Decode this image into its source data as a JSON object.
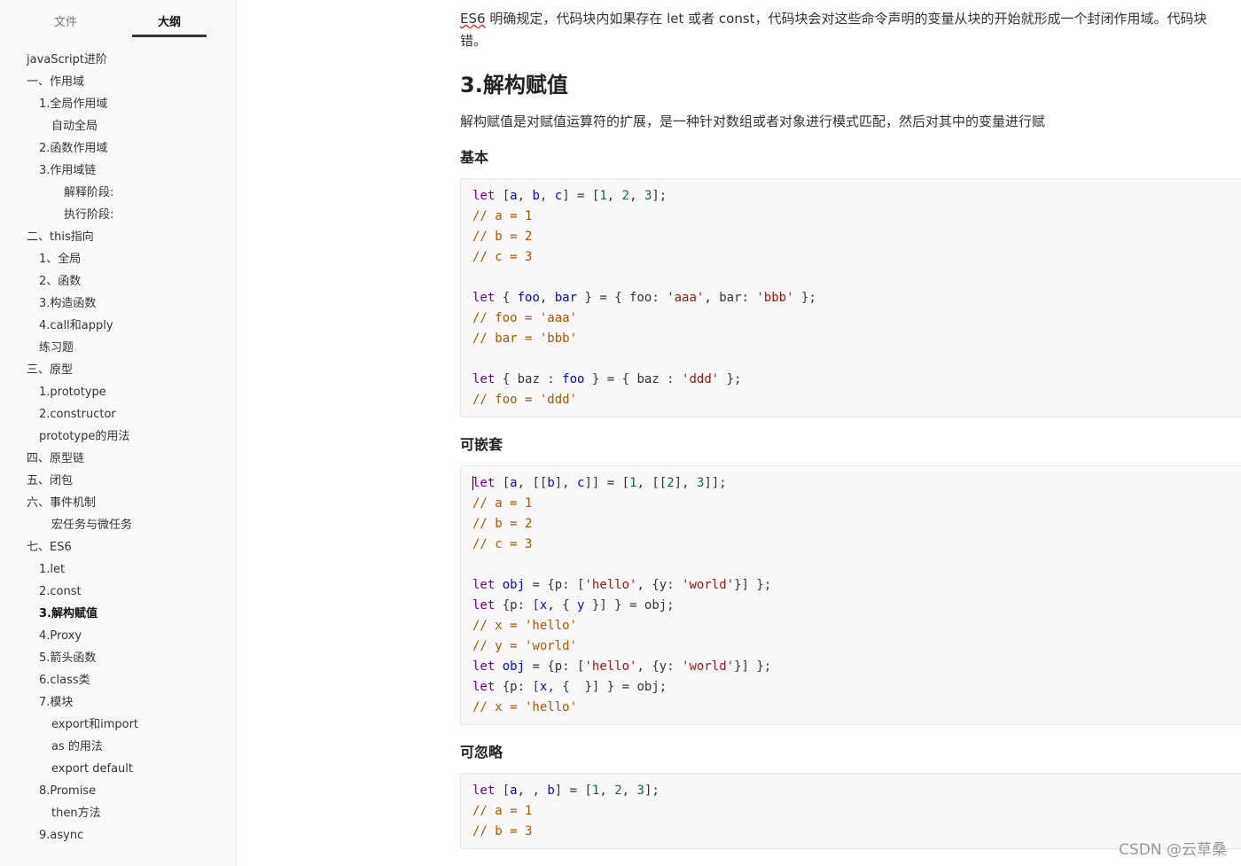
{
  "sidebar": {
    "tabs": [
      {
        "label": "文件",
        "active": false
      },
      {
        "label": "大纲",
        "active": true
      }
    ],
    "outline": [
      {
        "label": "javaScript进阶",
        "level": 1
      },
      {
        "label": "一、作用域",
        "level": 1
      },
      {
        "label": "1.全局作用域",
        "level": 2
      },
      {
        "label": "自动全局",
        "level": 3
      },
      {
        "label": "2.函数作用域",
        "level": 2
      },
      {
        "label": "3.作用域链",
        "level": 2
      },
      {
        "label": "解释阶段:",
        "level": 4
      },
      {
        "label": "执行阶段:",
        "level": 4
      },
      {
        "label": "二、this指向",
        "level": 1
      },
      {
        "label": "1、全局",
        "level": 2
      },
      {
        "label": "2、函数",
        "level": 2
      },
      {
        "label": "3.构造函数",
        "level": 2
      },
      {
        "label": "4.call和apply",
        "level": 2
      },
      {
        "label": "练习题",
        "level": 2
      },
      {
        "label": "三、原型",
        "level": 1
      },
      {
        "label": "1.prototype",
        "level": 2
      },
      {
        "label": "2.constructor",
        "level": 2
      },
      {
        "label": "prototype的用法",
        "level": 2
      },
      {
        "label": "四、原型链",
        "level": 1
      },
      {
        "label": "五、闭包",
        "level": 1
      },
      {
        "label": "六、事件机制",
        "level": 1
      },
      {
        "label": "宏任务与微任务",
        "level": 3
      },
      {
        "label": "七、ES6",
        "level": 1
      },
      {
        "label": "1.let",
        "level": 2
      },
      {
        "label": "2.const",
        "level": 2
      },
      {
        "label": "3.解构赋值",
        "level": 2,
        "active": true
      },
      {
        "label": "4.Proxy",
        "level": 2
      },
      {
        "label": "5.箭头函数",
        "level": 2
      },
      {
        "label": "6.class类",
        "level": 2
      },
      {
        "label": "7.模块",
        "level": 2
      },
      {
        "label": "export和import",
        "level": 3
      },
      {
        "label": "as 的用法",
        "level": 3
      },
      {
        "label": "export default",
        "level": 3
      },
      {
        "label": "8.Promise",
        "level": 2
      },
      {
        "label": "then方法",
        "level": 3
      },
      {
        "label": "9.async",
        "level": 2
      }
    ]
  },
  "main": {
    "intro": {
      "lead": "ES6",
      "line1": " 明确规定，代码块内如果存在 let 或者 const，代码块会对这些命令声明的变量从块的开始就形成一个封闭作用域。代码块",
      "line2": "错。"
    },
    "heading": "3.解构赋值",
    "description": "解构赋值是对赋值运算符的扩展，是一种针对数组或者对象进行模式匹配，然后对其中的变量进行赋",
    "sections": [
      {
        "title": "基本",
        "code": [
          [
            [
              "kw",
              "let"
            ],
            [
              "p",
              " ["
            ],
            [
              "v",
              "a"
            ],
            [
              "p",
              ", "
            ],
            [
              "v",
              "b"
            ],
            [
              "p",
              ", "
            ],
            [
              "v",
              "c"
            ],
            [
              "p",
              "] = ["
            ],
            [
              "n",
              "1"
            ],
            [
              "p",
              ", "
            ],
            [
              "n",
              "2"
            ],
            [
              "p",
              ", "
            ],
            [
              "n",
              "3"
            ],
            [
              "p",
              "];"
            ]
          ],
          [
            [
              "c",
              "// a = 1"
            ]
          ],
          [
            [
              "c",
              "// b = 2"
            ]
          ],
          [
            [
              "c",
              "// c = 3"
            ]
          ],
          [],
          [
            [
              "kw",
              "let"
            ],
            [
              "p",
              " { "
            ],
            [
              "v",
              "foo"
            ],
            [
              "p",
              ", "
            ],
            [
              "v",
              "bar"
            ],
            [
              "p",
              " } = { foo: "
            ],
            [
              "s",
              "'aaa'"
            ],
            [
              "p",
              ", bar: "
            ],
            [
              "s",
              "'bbb'"
            ],
            [
              "p",
              " };"
            ]
          ],
          [
            [
              "c",
              "// foo = 'aaa'"
            ]
          ],
          [
            [
              "c",
              "// bar = 'bbb'"
            ]
          ],
          [],
          [
            [
              "kw",
              "let"
            ],
            [
              "p",
              " { baz : "
            ],
            [
              "v",
              "foo"
            ],
            [
              "p",
              " } = { baz : "
            ],
            [
              "s",
              "'ddd'"
            ],
            [
              "p",
              " };"
            ]
          ],
          [
            [
              "c",
              "// foo = 'ddd'"
            ]
          ]
        ]
      },
      {
        "title": "可嵌套",
        "code": [
          [
            [
              "kw",
              "let"
            ],
            [
              "p",
              " ["
            ],
            [
              "v",
              "a"
            ],
            [
              "p",
              ", [["
            ],
            [
              "v",
              "b"
            ],
            [
              "p",
              "], "
            ],
            [
              "v",
              "c"
            ],
            [
              "p",
              "]] = ["
            ],
            [
              "n",
              "1"
            ],
            [
              "p",
              ", [["
            ],
            [
              "n",
              "2"
            ],
            [
              "p",
              "], "
            ],
            [
              "n",
              "3"
            ],
            [
              "p",
              "]];"
            ]
          ],
          [
            [
              "c",
              "// a = 1"
            ]
          ],
          [
            [
              "c",
              "// b = 2"
            ]
          ],
          [
            [
              "c",
              "// c = 3"
            ]
          ],
          [],
          [
            [
              "kw",
              "let"
            ],
            [
              "p",
              " "
            ],
            [
              "v",
              "obj"
            ],
            [
              "p",
              " = {p: ["
            ],
            [
              "s",
              "'hello'"
            ],
            [
              "p",
              ", {y: "
            ],
            [
              "s",
              "'world'"
            ],
            [
              "p",
              "}] };"
            ]
          ],
          [
            [
              "kw",
              "let"
            ],
            [
              "p",
              " {p: ["
            ],
            [
              "v",
              "x"
            ],
            [
              "p",
              ", { "
            ],
            [
              "v",
              "y"
            ],
            [
              "p",
              " }] } = obj;"
            ]
          ],
          [
            [
              "c",
              "// x = 'hello'"
            ]
          ],
          [
            [
              "c",
              "// y = 'world'"
            ]
          ],
          [
            [
              "kw",
              "let"
            ],
            [
              "p",
              " "
            ],
            [
              "v",
              "obj"
            ],
            [
              "p",
              " = {p: ["
            ],
            [
              "s",
              "'hello'"
            ],
            [
              "p",
              ", {y: "
            ],
            [
              "s",
              "'world'"
            ],
            [
              "p",
              "}] };"
            ]
          ],
          [
            [
              "kw",
              "let"
            ],
            [
              "p",
              " {p: ["
            ],
            [
              "v",
              "x"
            ],
            [
              "p",
              ", {  }] } = obj;"
            ]
          ],
          [
            [
              "c",
              "// x = 'hello'"
            ]
          ]
        ]
      },
      {
        "title": "可忽略",
        "code": [
          [
            [
              "kw",
              "let"
            ],
            [
              "p",
              " ["
            ],
            [
              "v",
              "a"
            ],
            [
              "p",
              ", , "
            ],
            [
              "v",
              "b"
            ],
            [
              "p",
              "] = ["
            ],
            [
              "n",
              "1"
            ],
            [
              "p",
              ", "
            ],
            [
              "n",
              "2"
            ],
            [
              "p",
              ", "
            ],
            [
              "n",
              "3"
            ],
            [
              "p",
              "];"
            ]
          ],
          [
            [
              "c",
              "// a = 1"
            ]
          ],
          [
            [
              "c",
              "// b = 3"
            ]
          ]
        ]
      }
    ]
  },
  "watermark": "CSDN @云草桑",
  "colors": {
    "keyword": "#770088",
    "variable": "#0000ff",
    "string": "#aa1111",
    "number": "#116644",
    "comment": "#aa5500"
  }
}
